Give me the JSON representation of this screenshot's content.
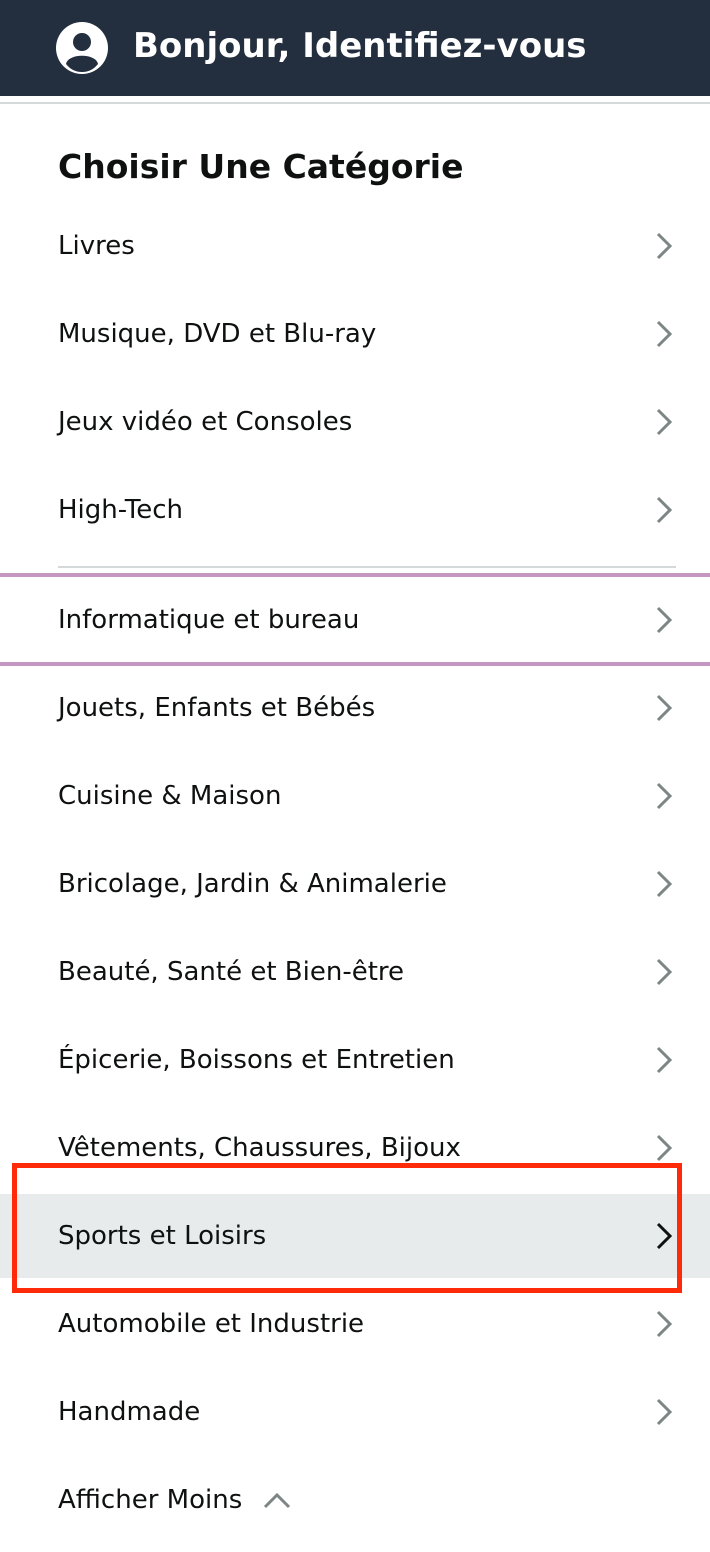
{
  "header": {
    "greeting": "Bonjour, Identifiez-vous",
    "avatar_icon": "user-circle-icon",
    "background_color": "#232f3e"
  },
  "menu": {
    "title": "Choisir Une Catégorie",
    "items": [
      {
        "label": "Livres"
      },
      {
        "label": "Musique, DVD et Blu-ray"
      },
      {
        "label": "Jeux vidéo et Consoles"
      },
      {
        "label": "High-Tech"
      },
      {
        "label": "Informatique et bureau"
      },
      {
        "label": "Jouets, Enfants et Bébés"
      },
      {
        "label": "Cuisine & Maison"
      },
      {
        "label": "Bricolage, Jardin & Animalerie"
      },
      {
        "label": "Beauté, Santé et Bien-être"
      },
      {
        "label": "Épicerie, Boissons et Entretien"
      },
      {
        "label": "Vêtements, Chaussures, Bijoux"
      },
      {
        "label": "Sports et Loisirs",
        "selected": true
      },
      {
        "label": "Automobile et Industrie"
      },
      {
        "label": "Handmade"
      }
    ],
    "show_less_label": "Afficher Moins",
    "chevron_icon": "chevron-right-icon",
    "caret_icon": "chevron-up-icon"
  },
  "colors": {
    "selected_background": "#e7ebeb",
    "highlight_border": "#ff2a0a",
    "focus_divider": "#c497c3"
  }
}
